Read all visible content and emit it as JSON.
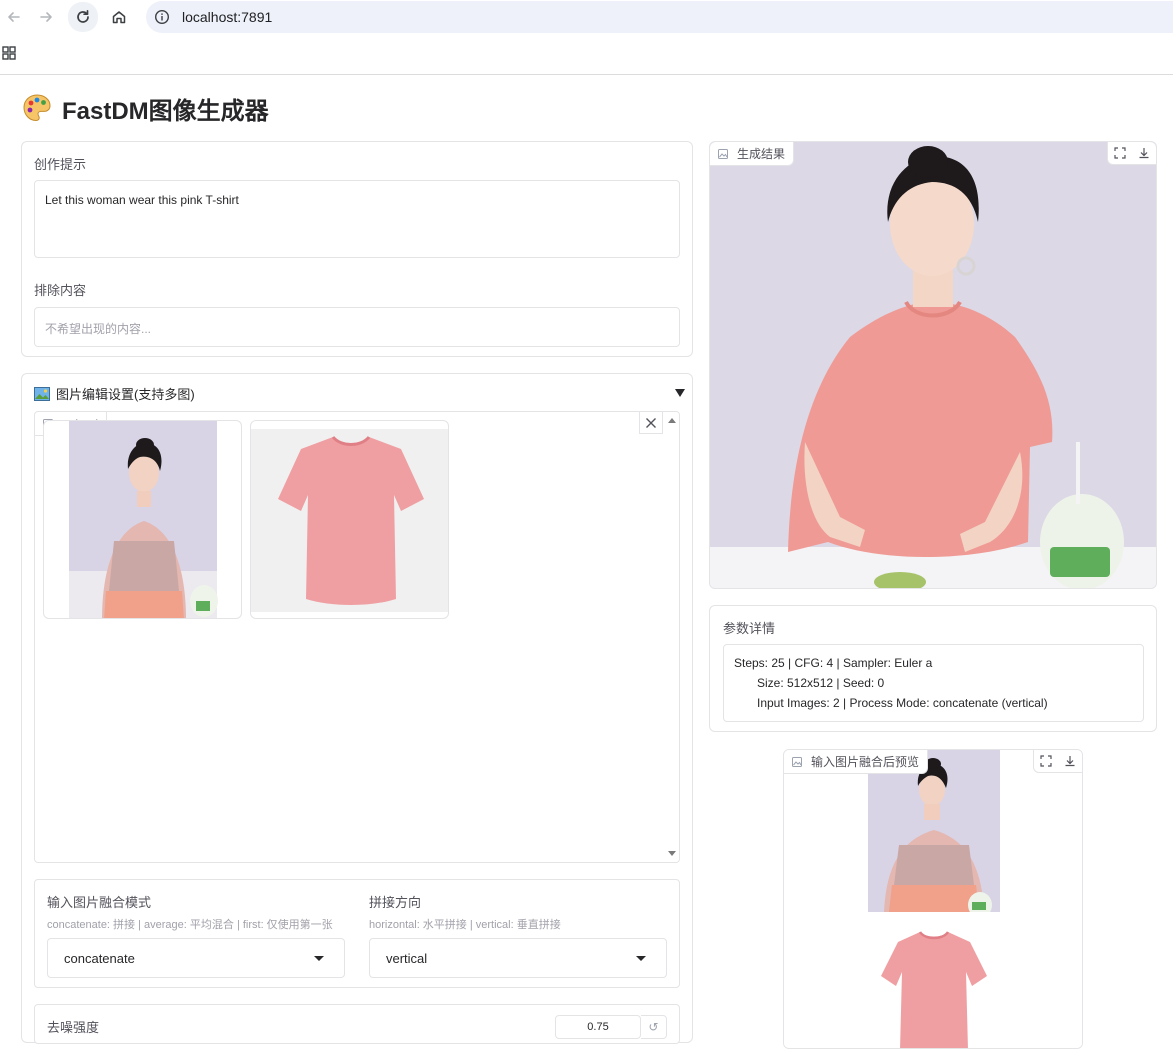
{
  "browser": {
    "url": "localhost:7891"
  },
  "app": {
    "title": "FastDM图像生成器",
    "title_icon": "palette-emoji"
  },
  "prompt_panel": {
    "prompt_label": "创作提示",
    "prompt_value": "Let this woman wear this pink T-shirt",
    "negative_label": "排除内容",
    "negative_placeholder": "不希望出现的内容..."
  },
  "edit_panel": {
    "title": "图片编辑设置(支持多图)",
    "title_icon": "picture-emoji",
    "upload_label": "upload",
    "thumbnails": [
      "woman-photo",
      "pink-tshirt-photo"
    ],
    "fusion_mode": {
      "label": "输入图片融合模式",
      "hint": "concatenate: 拼接 | average: 平均混合 | first: 仅使用第一张",
      "value": "concatenate"
    },
    "direction": {
      "label": "拼接方向",
      "hint": "horizontal: 水平拼接 | vertical: 垂直拼接",
      "value": "vertical"
    },
    "denoise": {
      "label": "去噪强度",
      "value": "0.75"
    }
  },
  "result": {
    "label": "生成结果"
  },
  "params": {
    "label": "参数详情",
    "line1": "Steps: 25 | CFG: 4 | Sampler: Euler a",
    "line2": "Size: 512x512 | Seed: 0",
    "line3": "Input Images: 2 | Process Mode: concatenate (vertical)"
  },
  "preview": {
    "label": "输入图片融合后预览"
  }
}
